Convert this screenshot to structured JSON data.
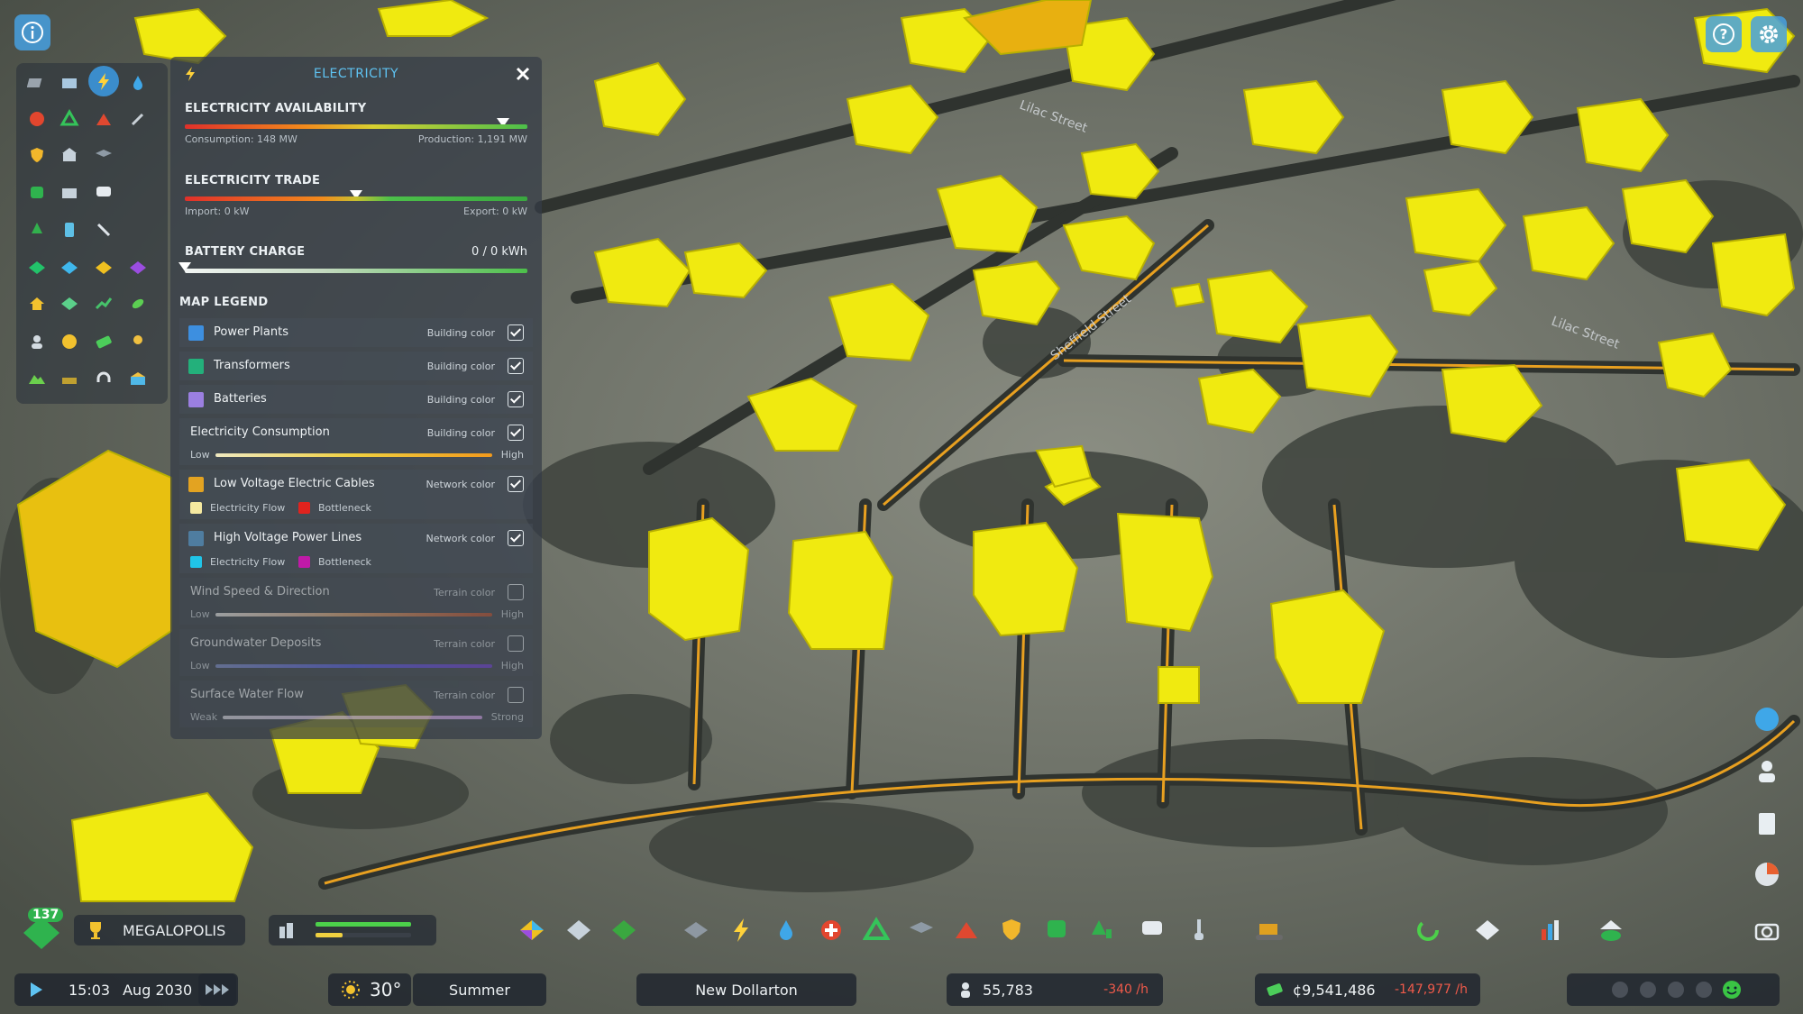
{
  "panel": {
    "title": "ELECTRICITY",
    "availability": {
      "label": "ELECTRICITY AVAILABILITY",
      "consumption": "Consumption: 148 MW",
      "production": "Production: 1,191 MW",
      "level": 0.93
    },
    "trade": {
      "label": "ELECTRICITY TRADE",
      "import": "Import: 0 kW",
      "export": "Export: 0 kW",
      "level": 0.5
    },
    "battery": {
      "label": "BATTERY CHARGE",
      "value": "0 / 0 kWh",
      "level": 0.0
    },
    "legend_title": "MAP LEGEND",
    "legend": [
      {
        "name": "Power Plants",
        "kind": "Building color",
        "checked": true,
        "color": "#3d8fe0"
      },
      {
        "name": "Transformers",
        "kind": "Building color",
        "checked": true,
        "color": "#23b07b"
      },
      {
        "name": "Batteries",
        "kind": "Building color",
        "checked": true,
        "color": "#9b7fe0"
      },
      {
        "name": "Electricity Consumption",
        "kind": "Building color",
        "checked": true,
        "low": "Low",
        "high": "High"
      },
      {
        "name": "Low Voltage Electric Cables",
        "kind": "Network color",
        "checked": true,
        "color": "#e3a321",
        "flow": "Electricity Flow",
        "flow_color": "#f5e9a0",
        "bottleneck": "Bottleneck",
        "bottleneck_color": "#e0231e"
      },
      {
        "name": "High Voltage Power Lines",
        "kind": "Network color",
        "checked": true,
        "color": "#4f7da0",
        "flow": "Electricity Flow",
        "flow_color": "#20c5e8",
        "bottleneck": "Bottleneck",
        "bottleneck_color": "#c01aa8"
      },
      {
        "name": "Wind Speed & Direction",
        "kind": "Terrain color",
        "checked": false,
        "low": "Low",
        "high": "High"
      },
      {
        "name": "Groundwater Deposits",
        "kind": "Terrain color",
        "checked": false,
        "low": "Low",
        "high": "High"
      },
      {
        "name": "Surface Water Flow",
        "kind": "Terrain color",
        "checked": false,
        "low": "Weak",
        "high": "Strong"
      }
    ]
  },
  "map_labels": [
    "Lilac Street",
    "Sheffield Street",
    "Lilac Street"
  ],
  "status": {
    "milestone_level": "137",
    "milestone": "MEGALOPOLIS",
    "time": "15:03",
    "date": "Aug 2030",
    "temperature": "30°",
    "season": "Summer",
    "city": "New Dollarton",
    "population": "55,783",
    "population_change": "-340 /h",
    "money": "¢9,541,486",
    "money_change": "-147,977 /h"
  },
  "colors": {
    "accent": "#5fc3f2",
    "building": "#f0ea10",
    "road": "#e8a020"
  }
}
